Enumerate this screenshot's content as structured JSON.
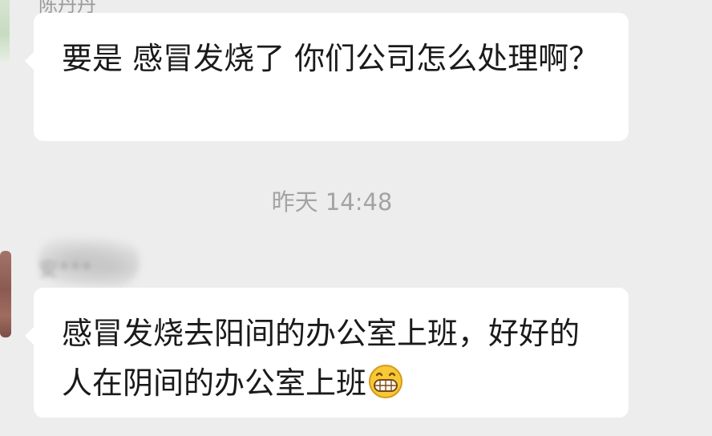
{
  "messages": [
    {
      "sender_name": "陈丹丹",
      "text": "要是 感冒发烧了  你们公司怎么处理啊？"
    },
    {
      "sender_name": "安***",
      "text": "感冒发烧去阳间的办公室上班，好好的人在阴间的办公室上班",
      "emoji": "grinning-face-emoji"
    }
  ],
  "timestamp": "昨天 14:48",
  "colors": {
    "background": "#ededed",
    "bubble": "#ffffff",
    "text": "#1a1a1a",
    "meta": "#a3a3a3"
  }
}
